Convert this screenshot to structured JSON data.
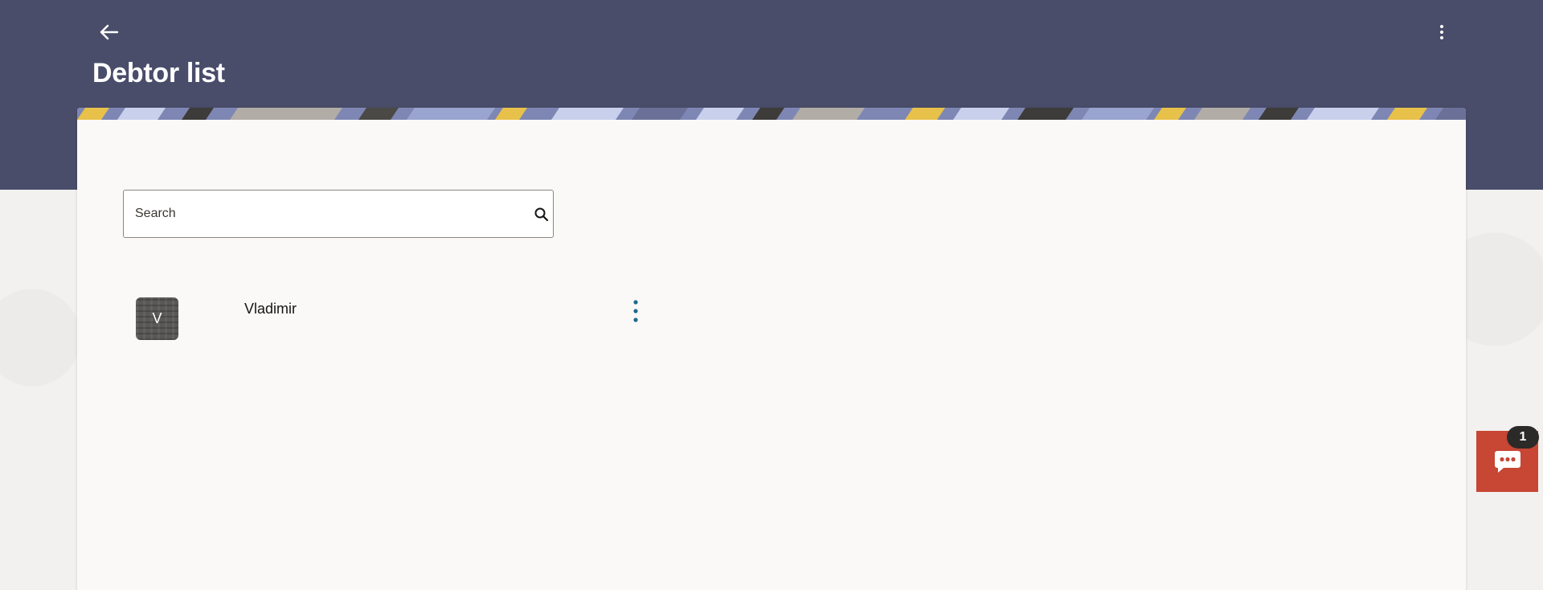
{
  "header": {
    "title": "Debtor list",
    "back_icon": "arrow-left-icon",
    "menu_icon": "more-vertical-icon",
    "background_color": "#494d6a"
  },
  "search": {
    "placeholder": "Search",
    "value": "",
    "icon": "search-icon"
  },
  "debtors": [
    {
      "initial": "V",
      "name": "Vladimir",
      "menu_icon": "more-vertical-icon"
    }
  ],
  "chat": {
    "icon": "chat-bubble-icon",
    "badge_count": "1",
    "color": "#c74634"
  },
  "colors": {
    "card_background": "#faf9f8",
    "page_background": "#f3f1ef",
    "kebab_accent": "#1e6a8c"
  }
}
